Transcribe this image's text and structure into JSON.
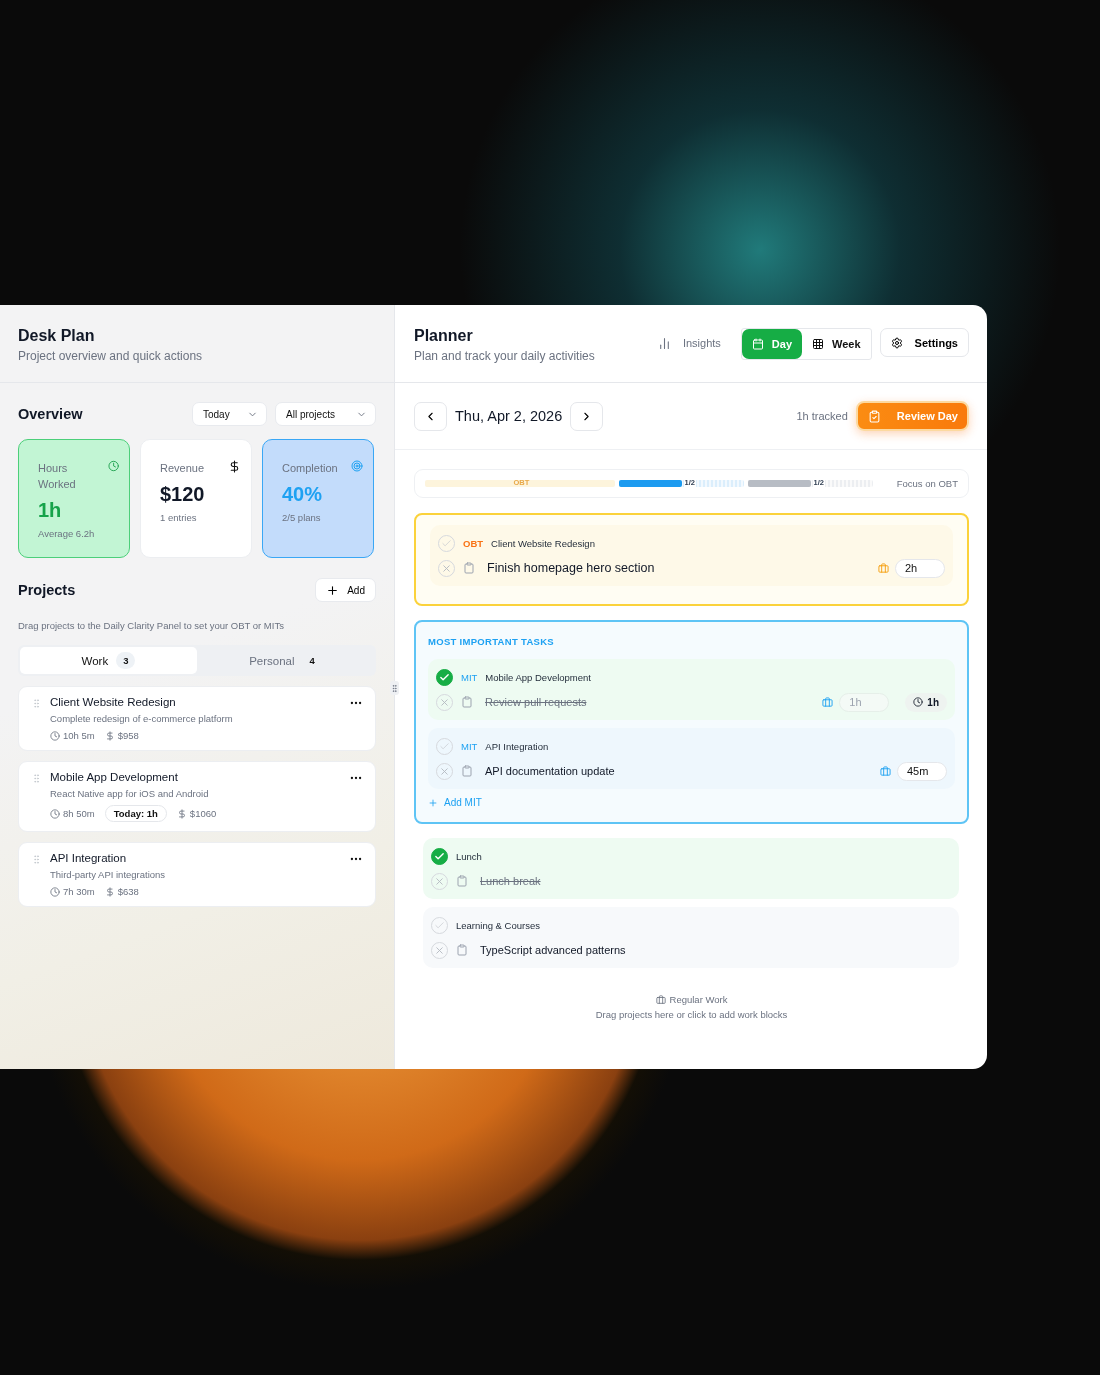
{
  "sidebar": {
    "title": "Desk Plan",
    "subtitle": "Project overview and quick actions"
  },
  "overview": {
    "title": "Overview",
    "filters": [
      "Today",
      "All projects"
    ],
    "stats": [
      {
        "kind": "hours",
        "label": "Hours Worked",
        "value": "1h",
        "note": "Average 6.2h"
      },
      {
        "kind": "revenue",
        "label": "Revenue",
        "value": "$120",
        "note": "1 entries"
      },
      {
        "kind": "completion",
        "label": "Completion",
        "value": "40%",
        "note": "2/5 plans"
      }
    ]
  },
  "projects": {
    "title": "Projects",
    "add": "Add",
    "hint": "Drag projects to the Daily Clarity Panel to set your OBT or MITs",
    "tabs": [
      {
        "label": "Work",
        "count": "3",
        "selected": true
      },
      {
        "label": "Personal",
        "count": "4",
        "selected": false
      }
    ],
    "items": [
      {
        "name": "Client Website Redesign",
        "description": "Complete redesign of e-commerce platform",
        "time": "10h 5m",
        "amount": "$958"
      },
      {
        "name": "Mobile App Development",
        "description": "React Native app for iOS and Android",
        "time": "8h 50m",
        "today": "Today: 1h",
        "amount": "$1060"
      },
      {
        "name": "API Integration",
        "description": "Third-party API integrations",
        "time": "7h 30m",
        "amount": "$638"
      }
    ]
  },
  "planner": {
    "title": "Planner",
    "subtitle": "Plan and track your daily activities",
    "insights": "Insights",
    "views": [
      {
        "label": "Day",
        "selected": true
      },
      {
        "label": "Week",
        "selected": false
      }
    ],
    "settings": "Settings"
  },
  "day": {
    "date": "Thu, Apr 2, 2026",
    "tracked": "1h tracked",
    "review": "Review Day"
  },
  "focus": {
    "segments": [
      {
        "kind": "obt",
        "label": "OBT"
      },
      {
        "kind": "mit",
        "label": "1/2",
        "level": 0.5
      },
      {
        "kind": "other",
        "label": "1/2",
        "level": 0.5
      }
    ],
    "label": "Focus on OBT"
  },
  "obt": {
    "blocks": [
      {
        "tag": "OBT",
        "project": "Client Website Redesign",
        "task": "Finish homepage hero section",
        "estimate": "2h",
        "checked": false,
        "done": false
      }
    ]
  },
  "mit": {
    "title": "MOST IMPORTANT TASKS",
    "add": "Add MIT",
    "blocks": [
      {
        "tag": "MIT",
        "project": "Mobile App Development",
        "task": "Review pull requests",
        "estimate": "1h",
        "tracked": "1h",
        "checked": true,
        "done": true
      },
      {
        "tag": "MIT",
        "project": "API Integration",
        "task": "API documentation update",
        "estimate": "45m",
        "checked": false,
        "done": false
      }
    ]
  },
  "blocks": [
    {
      "project": "Lunch",
      "task": "Lunch break",
      "checked": true,
      "done": true
    },
    {
      "project": "Learning & Courses",
      "task": "TypeScript advanced patterns",
      "checked": false,
      "done": false
    }
  ],
  "drop_zone": {
    "title": "Regular Work",
    "hint": "Drag projects here or click to add work blocks"
  }
}
